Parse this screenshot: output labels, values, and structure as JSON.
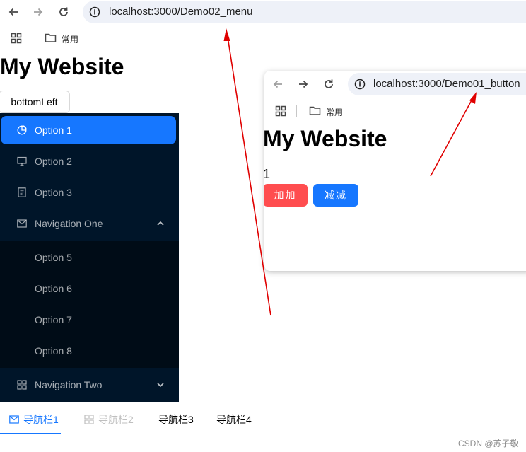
{
  "browser": {
    "url_host": "localhost",
    "url_path": ":3000/Demo02_menu",
    "bookmark_folder": "常用"
  },
  "page": {
    "title": "My Website",
    "dropdown_button": "bottomLeft"
  },
  "menu": {
    "items": [
      {
        "label": "Option 1",
        "icon": "pie-chart-icon",
        "selected": true
      },
      {
        "label": "Option 2",
        "icon": "desktop-icon"
      },
      {
        "label": "Option 3",
        "icon": "container-icon"
      },
      {
        "label": "Navigation One",
        "icon": "mail-icon",
        "expanded": true
      },
      {
        "label": "Navigation Two",
        "icon": "appstore-icon",
        "expanded": false
      }
    ],
    "submenu": [
      "Option 5",
      "Option 6",
      "Option 7",
      "Option 8"
    ],
    "colors": {
      "background": "#001529",
      "submenu_background": "#000c17",
      "selected": "#1677ff"
    }
  },
  "tabs": [
    {
      "label": "导航栏1",
      "icon": "mail-icon",
      "state": "active"
    },
    {
      "label": "导航栏2",
      "icon": "appstore-icon",
      "state": "disabled"
    },
    {
      "label": "导航栏3",
      "state": "normal"
    },
    {
      "label": "导航栏4",
      "state": "normal"
    }
  ],
  "inset": {
    "url_host": "localhost",
    "url_path": ":3000/Demo01_button",
    "bookmark_folder": "常用",
    "title": "My Website",
    "count": "1",
    "add_button": "加加",
    "subtract_button": "减减",
    "colors": {
      "add": "#ff4d4f",
      "subtract": "#1677ff"
    }
  },
  "watermark": "CSDN @苏子敬",
  "annotation_color": "#e00000"
}
